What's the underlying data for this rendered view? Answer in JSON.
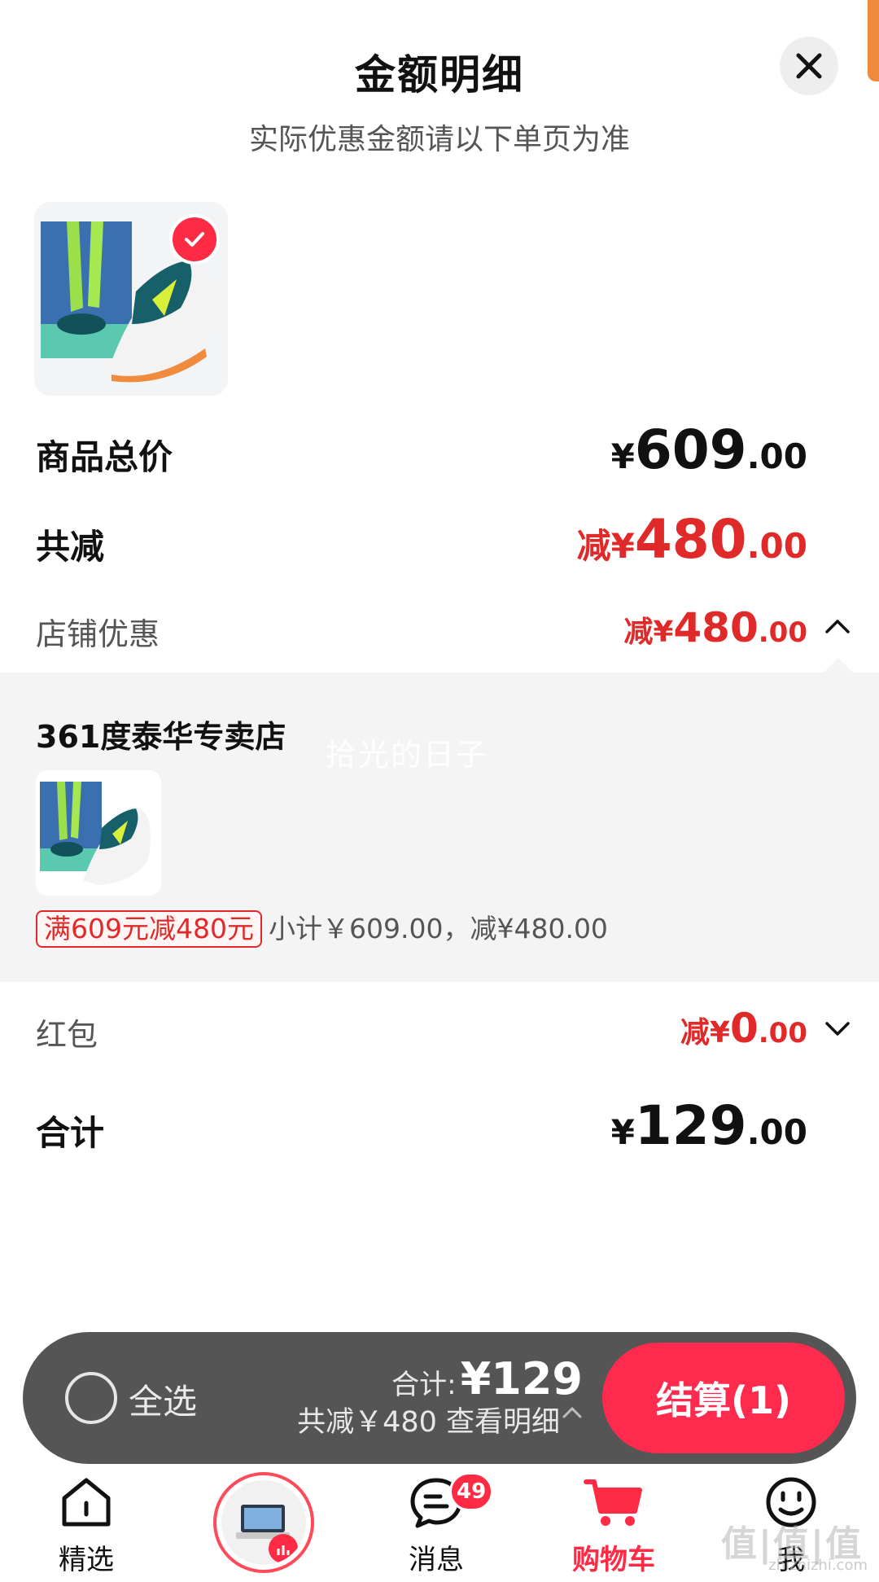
{
  "header": {
    "title": "金额明细",
    "subtitle": "实际优惠金额请以下单页为准"
  },
  "summary": {
    "goods_total_label": "商品总价",
    "goods_total_symbol": "¥",
    "goods_total_int": "609",
    "goods_total_dec": ".00",
    "discount_label": "共减",
    "discount_prefix": "减¥",
    "discount_int": "480",
    "discount_dec": ".00",
    "store_discount_label": "店铺优惠",
    "store_discount_prefix": "减¥",
    "store_discount_int": "480",
    "store_discount_dec": ".00",
    "redpacket_label": "红包",
    "redpacket_prefix": "减¥",
    "redpacket_int": "0",
    "redpacket_dec": ".00",
    "total_label": "合计",
    "total_symbol": "¥",
    "total_int": "129",
    "total_dec": ".00"
  },
  "store": {
    "name": "361度泰华专卖店",
    "watermark": "拾光的日子",
    "promo_tag": "满609元减480元",
    "subtotal_text": "小计￥609.00，减¥480.00"
  },
  "cart_bar": {
    "select_all": "全选",
    "total_label": "合计:",
    "total_value": "¥129",
    "saved_text": "共减￥480 查看明细",
    "checkout": "结算(1)"
  },
  "tabs": [
    {
      "label": "精选",
      "icon": "home-icon"
    },
    {
      "label": "",
      "icon": "promo-icon"
    },
    {
      "label": "消息",
      "icon": "message-icon",
      "badge": "49"
    },
    {
      "label": "购物车",
      "icon": "cart-icon",
      "active": true
    },
    {
      "label": "我",
      "icon": "profile-icon"
    }
  ],
  "site_watermark": "值|值|值",
  "site_watermark_url": "zhizhizhi.com",
  "colors": {
    "accent_red": "#e02a2a",
    "checkout_pink": "#ff2b4e",
    "bar_gray": "#555555",
    "panel_bg": "#f4f4f4"
  }
}
